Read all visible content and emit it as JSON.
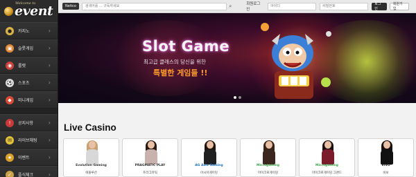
{
  "logo": {
    "text": "event",
    "tagline": "Welcome to"
  },
  "sidebar": {
    "items": [
      {
        "label": "카지노",
        "icon": "casino-chip-icon",
        "color": "#d9b24a"
      },
      {
        "label": "슬롯게임",
        "icon": "slot-icon",
        "color": "#e08a3a"
      },
      {
        "label": "룰렛",
        "icon": "roulette-icon",
        "color": "#c9423d"
      },
      {
        "label": "스포츠",
        "icon": "sports-ball-icon",
        "color": "#e0e0e0"
      },
      {
        "label": "미니게임",
        "icon": "minigame-icon",
        "color": "#d64c3a"
      },
      {
        "label": "공지사항",
        "icon": "notice-icon",
        "color": "#c83a3a"
      },
      {
        "label": "라이브채팅",
        "icon": "chat-icon",
        "color": "#e2c23a"
      },
      {
        "label": "이벤트",
        "icon": "event-icon",
        "color": "#d9a12a"
      },
      {
        "label": "플식체크",
        "icon": "check-icon",
        "color": "#c9a24a"
      }
    ]
  },
  "topbar": {
    "tag": "Netico",
    "search_placeholder": "검색어를 ... 구독하세요",
    "login_title": "회원로그인",
    "id_placeholder": "아이디",
    "pw_placeholder": "비밀번호",
    "login_button": "로그인",
    "signup_button": "회원가입"
  },
  "banner": {
    "title": "Slot Game",
    "subtitle": "최고급 클래스의 당신을 위한",
    "subtitle2": "특별한 게임들 !!"
  },
  "live": {
    "title": "Live Casino",
    "cards": [
      {
        "brand": "Evolution Gaming",
        "caption": "에볼루션",
        "brand_color": "#333333",
        "dress": "#d8d8d8",
        "hair": "#c8a070"
      },
      {
        "brand": "PRAGMATIC PLAY",
        "caption": "프라그마틱",
        "brand_color": "#333333",
        "dress": "#c9b2ae",
        "hair": "#2a1a12"
      },
      {
        "brand": "AG Asia Gaming",
        "caption": "아시아게이밍",
        "brand_color": "#1a6fbf",
        "dress": "#202020",
        "hair": "#1f130c"
      },
      {
        "brand": "Microgaming",
        "caption": "마이크로게이밍",
        "brand_color": "#3aa24a",
        "dress": "#3c2620",
        "hair": "#3a2418"
      },
      {
        "brand": "Microgaming",
        "caption": "마이크로게이밍 그랜드",
        "brand_color": "#3aa24a",
        "dress": "#7a1a2a",
        "hair": "#1a1010"
      },
      {
        "brand": "VIVO",
        "caption": "비보",
        "brand_color": "#222222",
        "dress": "#111111",
        "hair": "#1a1010"
      }
    ]
  }
}
